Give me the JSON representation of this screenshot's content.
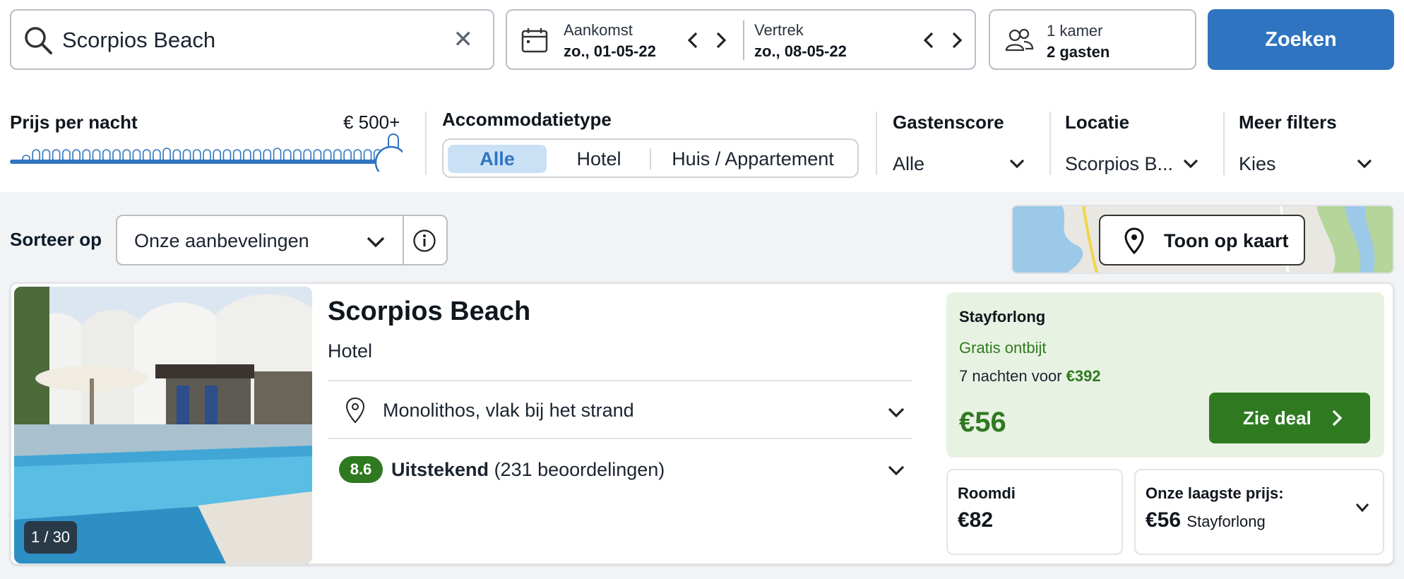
{
  "search": {
    "query": "Scorpios Beach"
  },
  "dates": {
    "arrival_label": "Aankomst",
    "arrival_value": "zo., 01-05-22",
    "departure_label": "Vertrek",
    "departure_value": "zo., 08-05-22"
  },
  "guests": {
    "rooms": "1 kamer",
    "guests": "2 gasten"
  },
  "search_button": "Zoeken",
  "filters": {
    "price": {
      "label": "Prijs per nacht",
      "value": "€ 500+",
      "slider_fraction": 1.0
    },
    "accommodation": {
      "label": "Accommodatietype",
      "options": [
        "Alle",
        "Hotel",
        "Huis / Appartement"
      ],
      "selected": "Alle"
    },
    "guest_score": {
      "label": "Gastenscore",
      "value": "Alle"
    },
    "location": {
      "label": "Locatie",
      "value": "Scorpios B..."
    },
    "more": {
      "label": "Meer filters",
      "value": "Kies"
    }
  },
  "sort": {
    "label": "Sorteer op",
    "value": "Onze aanbevelingen"
  },
  "map_button": "Toon op kaart",
  "result": {
    "photo_counter": "1 / 30",
    "name": "Scorpios Beach",
    "type": "Hotel",
    "location": "Monolithos, vlak bij het strand",
    "score": "8.6",
    "score_word": "Uitstekend",
    "reviews": "(231 beoordelingen)",
    "deal": {
      "provider": "Stayforlong",
      "perk": "Gratis ontbijt",
      "nights_text": "7 nachten voor",
      "nights_price": "€392",
      "price": "€56",
      "button": "Zie deal"
    },
    "alt1": {
      "provider": "Roomdi",
      "price": "€82"
    },
    "alt2": {
      "label": "Onze laagste prijs:",
      "price": "€56",
      "provider": "Stayforlong"
    }
  },
  "colors": {
    "brand_blue": "#2f74c0",
    "deal_green": "#2f7a21",
    "deal_bg": "#e8f2e2"
  }
}
